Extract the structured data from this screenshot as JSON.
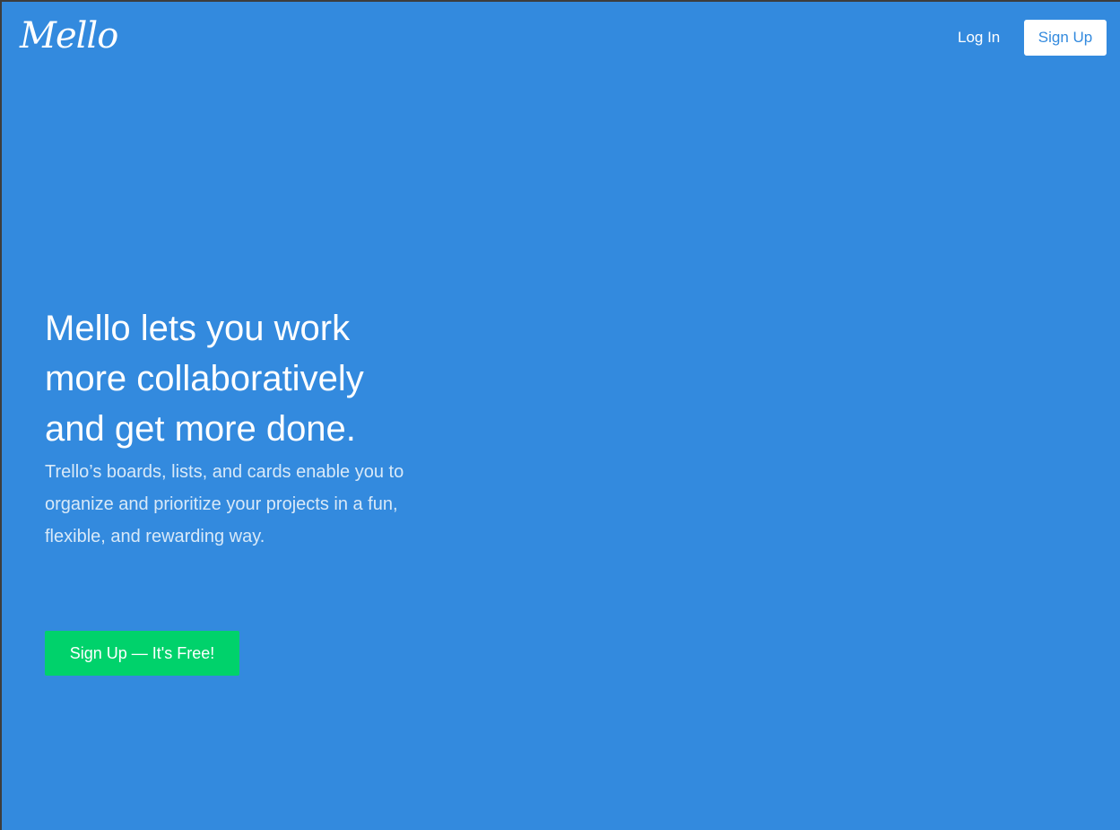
{
  "header": {
    "logo_text": "Mello",
    "login_label": "Log In",
    "signup_label": "Sign Up"
  },
  "hero": {
    "title": "Mello lets you work more collaboratively and get more done.",
    "subtitle": "Trello’s boards, lists, and cards enable you to organize and prioritize your projects in a fun, flexible, and rewarding way.",
    "cta_label": "Sign Up — It's Free!"
  },
  "colors": {
    "background": "#338ade",
    "cta": "#00d26b",
    "nav_button_bg": "#ffffff",
    "nav_button_text": "#338ade"
  }
}
